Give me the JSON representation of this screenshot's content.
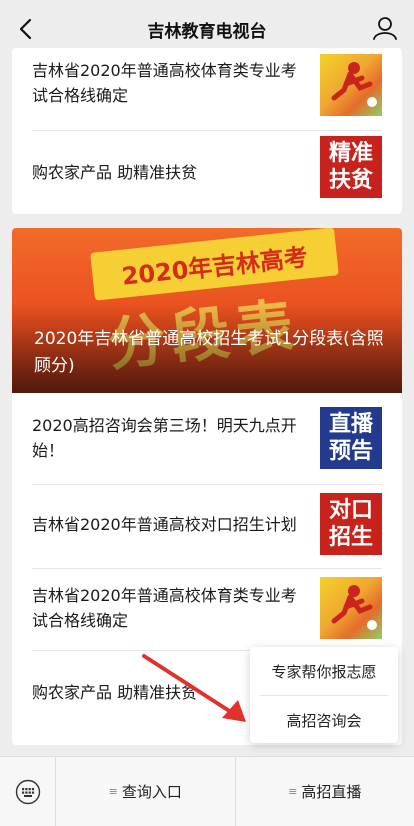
{
  "header": {
    "title": "吉林教育电视台"
  },
  "card1": {
    "items": [
      {
        "text": "吉林省2020年普通高校体育类专业考试合格线确定",
        "thumb": "sport-image"
      },
      {
        "text": "购农家产品 助精准扶贫",
        "thumb_text": "精准扶贫"
      }
    ]
  },
  "banner": {
    "ribbon": "2020年吉林高考",
    "big_text": "分段表",
    "title": "2020年吉林省普通高校招生考试1分段表(含照顾分)"
  },
  "card2": {
    "items": [
      {
        "text": "2020高招咨询会第三场！明天九点开始！",
        "thumb_text": "直播预告"
      },
      {
        "text": "吉林省2020年普通高校对口招生计划",
        "thumb_text": "对口招生"
      },
      {
        "text": "吉林省2020年普通高校体育类专业考试合格线确定",
        "thumb": "sport-image"
      },
      {
        "text": "购农家产品 助精准扶贫"
      }
    ]
  },
  "popup": {
    "items": [
      "专家帮你报志愿",
      "高招咨询会"
    ]
  },
  "tabbar": {
    "tabs": [
      "查询入口",
      "高招直播"
    ]
  },
  "colors": {
    "accent_red": "#c8221c",
    "accent_blue": "#233a8f",
    "arrow_red": "#e0322b"
  }
}
